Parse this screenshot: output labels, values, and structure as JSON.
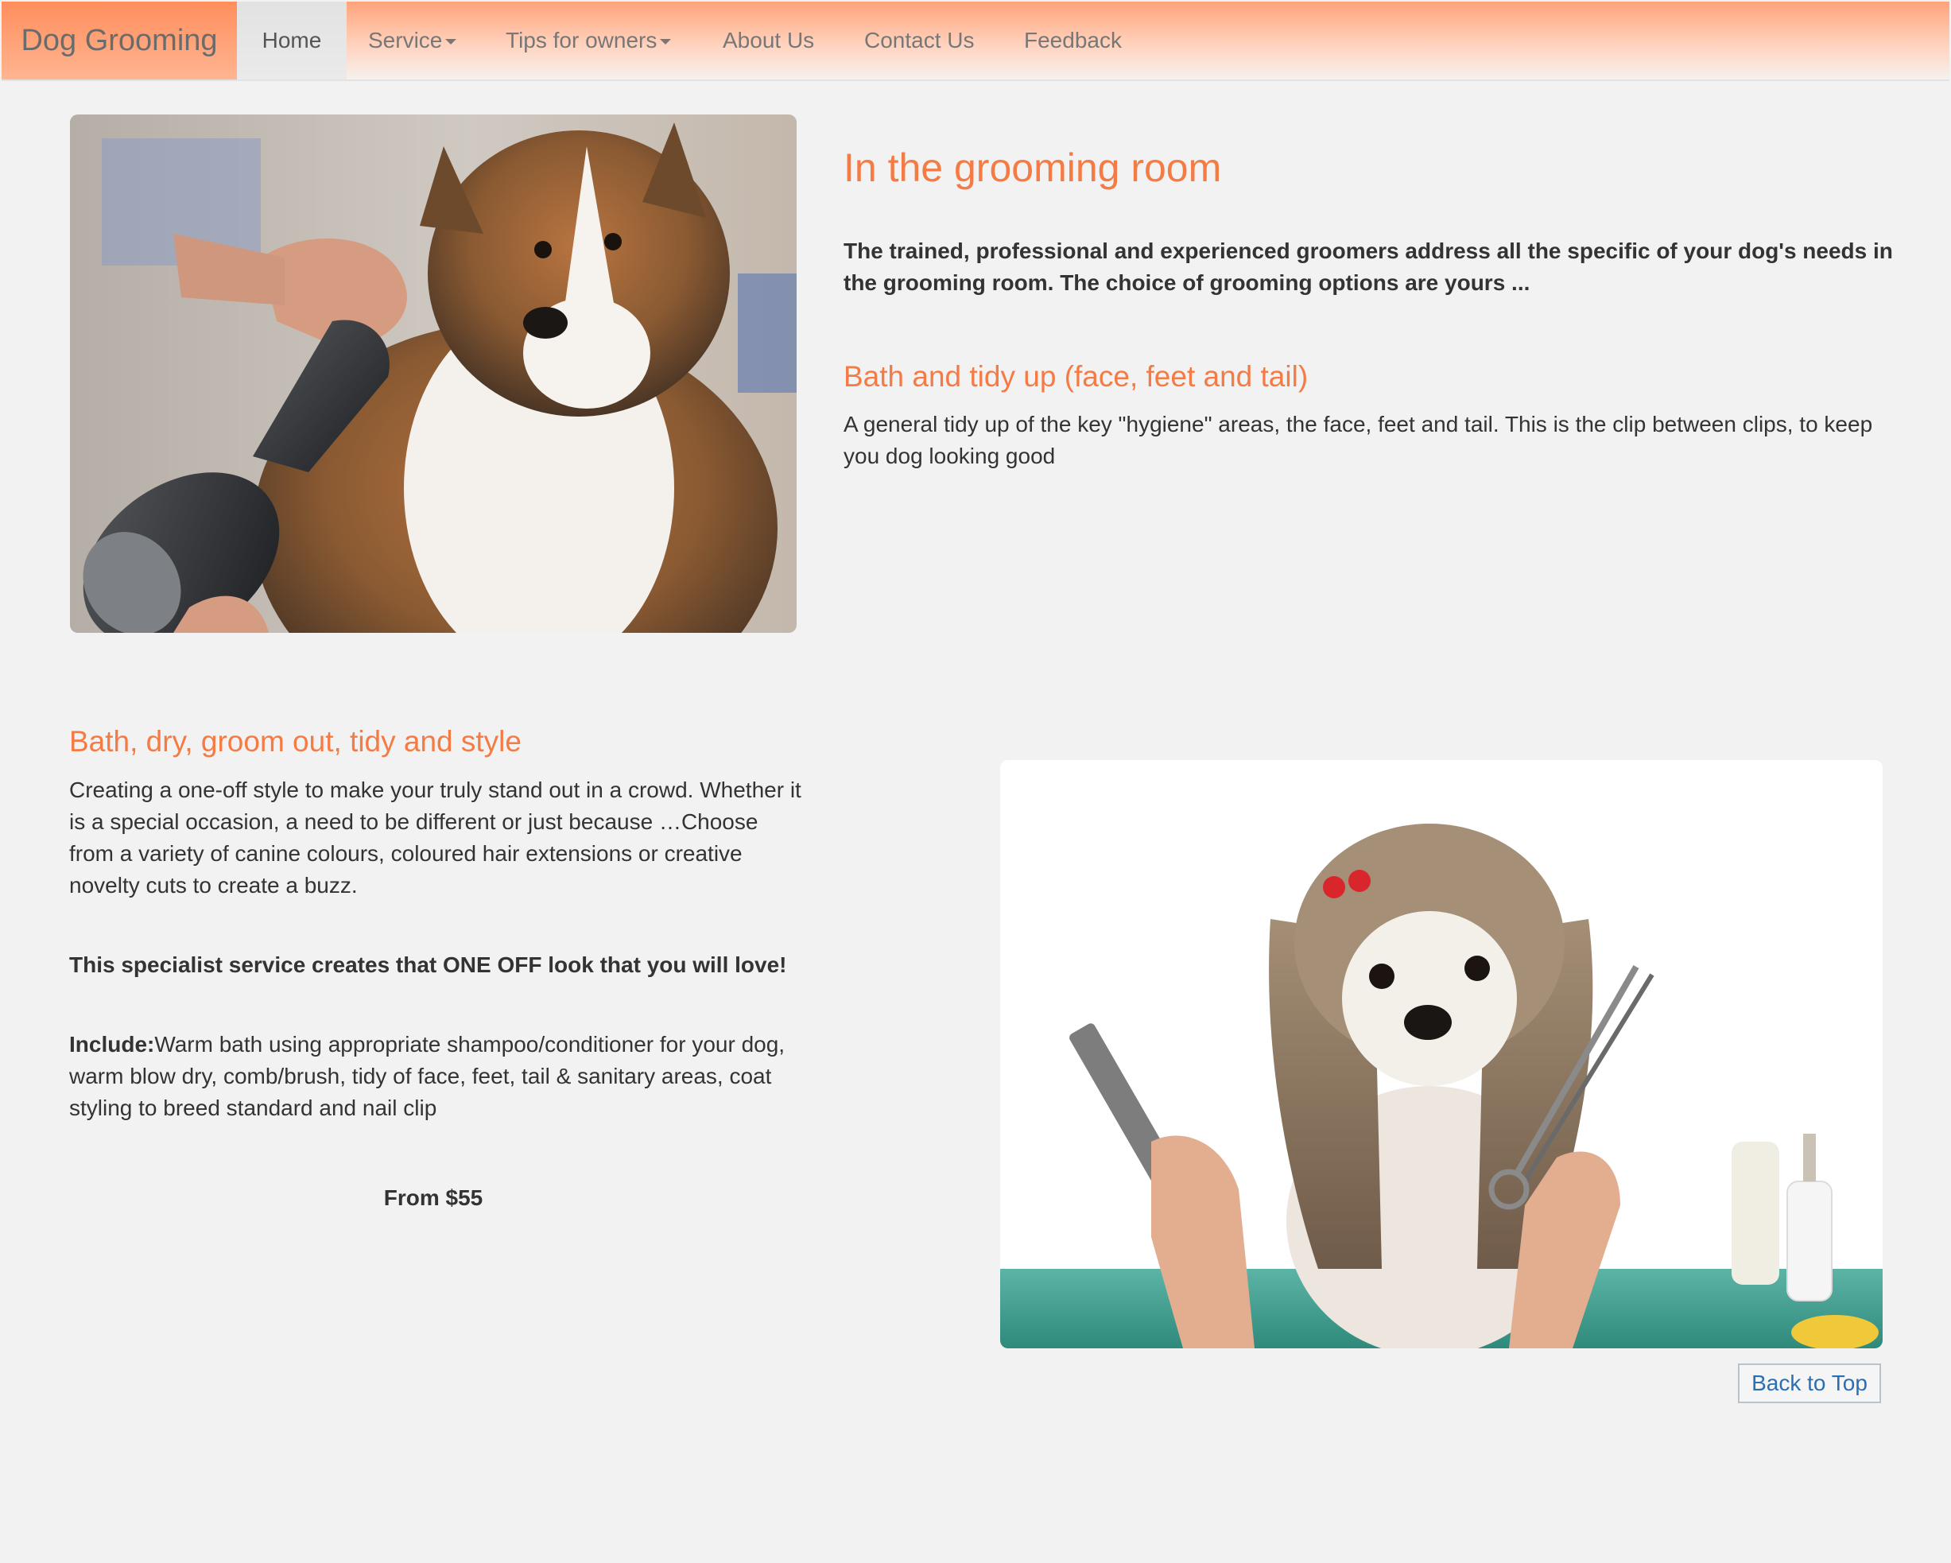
{
  "navbar": {
    "brand": "Dog Grooming",
    "items": [
      {
        "label": "Home",
        "active": true
      },
      {
        "label": "Service",
        "dropdown": true
      },
      {
        "label": "Tips for owners",
        "dropdown": true
      },
      {
        "label": "About Us"
      },
      {
        "label": "Contact Us"
      },
      {
        "label": "Feedback"
      }
    ]
  },
  "section1": {
    "image": "photo of a sheltie dog being blow dried",
    "title": "In the grooming room",
    "intro": "The trained, professional and experienced groomers address all the specific of your dog's needs in the grooming room. The choice of grooming options are yours ...",
    "service_title": "Bath and tidy up (face, feet and tail)",
    "service_desc": "A general tidy up of the key \"hygiene\" areas, the face, feet and tail. This is the clip between clips, to keep you dog looking good"
  },
  "section2": {
    "title": "Bath, dry, groom out, tidy and style",
    "desc": "Creating a one-off style to make your truly stand out in a crowd. Whether it is a special occasion, a need to be different or just because …Choose from a variety of canine colours, coloured hair extensions or creative novelty cuts to create a buzz.",
    "highlight": "This specialist service creates that ONE OFF look that you will love!",
    "include_label": "Include:",
    "include_text": "Warm bath using appropriate shampoo/conditioner for your dog, warm blow dry, comb/brush, tidy of face, feet, tail & sanitary areas, coat styling to breed standard and nail clip",
    "price": "From $55",
    "image": "photo of a shih tzu with comb and scissors"
  },
  "footer": {
    "back_to_top": "Back to Top"
  },
  "colors": {
    "accent": "#f57b45",
    "link": "#2a6fb3",
    "text": "#333333",
    "background": "#f2f2f2"
  }
}
